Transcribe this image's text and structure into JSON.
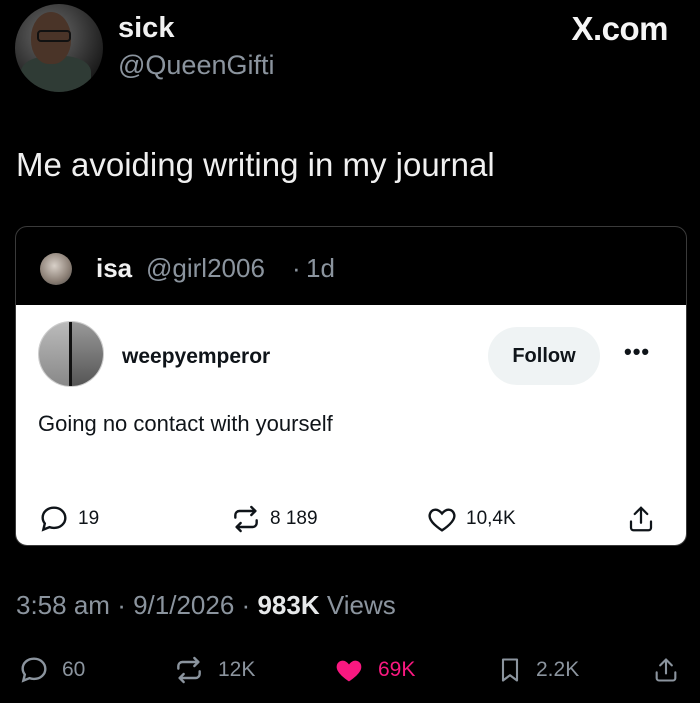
{
  "header": {
    "display_name": "sick",
    "handle": "@QueenGifti",
    "site": "X.com"
  },
  "tweet": {
    "text": "Me avoiding writing in my journal"
  },
  "quoted": {
    "author_name": "isa",
    "author_handle": "@girl2006",
    "separator": "·",
    "age": "1d",
    "embedded": {
      "author": "weepyemperor",
      "follow_label": "Follow",
      "more_label": "•••",
      "text": "Going no contact with yourself",
      "replies": "19",
      "reposts": "8 189",
      "likes": "10,4K"
    }
  },
  "meta": {
    "time": "3:58 am",
    "sep1": "·",
    "date": "9/1/2026",
    "sep2": "·",
    "views_count": "983K",
    "views_label": "Views"
  },
  "actions": {
    "replies": "60",
    "reposts": "12K",
    "likes": "69K",
    "bookmarks": "2.2K"
  },
  "colors": {
    "background": "#000000",
    "like_accent": "#f91880",
    "muted_text": "#8b949e"
  }
}
